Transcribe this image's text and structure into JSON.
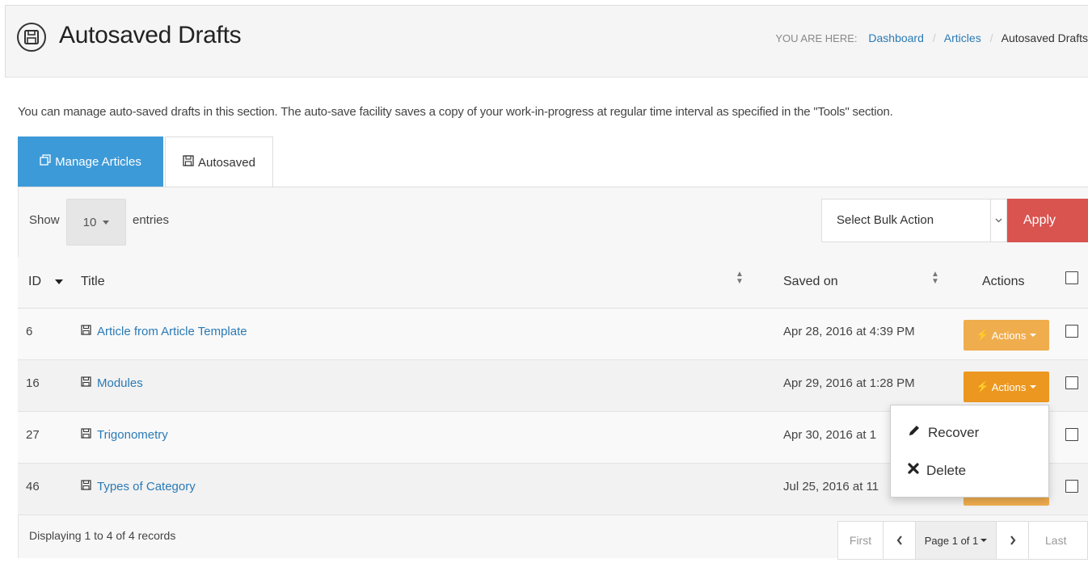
{
  "header": {
    "title": "Autosaved Drafts",
    "breadcrumb": {
      "label": "YOU ARE HERE:",
      "items": [
        "Dashboard",
        "Articles"
      ],
      "current": "Autosaved Drafts"
    }
  },
  "description": "You can manage auto-saved drafts in this section. The auto-save facility saves a copy of your work-in-progress at regular time interval as specified in the \"Tools\" section.",
  "tabs": [
    {
      "label": "Manage Articles",
      "icon": "copy-icon",
      "active": false
    },
    {
      "label": "Autosaved",
      "icon": "save-icon",
      "active": true
    }
  ],
  "toolbar": {
    "show_label": "Show",
    "page_length": "10",
    "entries_label": "entries",
    "bulk_action_placeholder": "Select Bulk Action",
    "apply_label": "Apply"
  },
  "table": {
    "columns": {
      "id": "ID",
      "title": "Title",
      "saved_on": "Saved on",
      "actions": "Actions"
    },
    "rows": [
      {
        "id": "6",
        "title": "Article from Article Template",
        "saved_on": "Apr 28, 2016 at 4:39 PM",
        "action_label": "Actions"
      },
      {
        "id": "16",
        "title": "Modules",
        "saved_on": "Apr 29, 2016 at 1:28 PM",
        "action_label": "Actions"
      },
      {
        "id": "27",
        "title": "Trigonometry",
        "saved_on": "Apr 30, 2016 at 1",
        "action_label": ""
      },
      {
        "id": "46",
        "title": "Types of Category",
        "saved_on": "Jul 25, 2016 at 11",
        "action_label": ""
      }
    ]
  },
  "dropdown": {
    "items": [
      {
        "label": "Recover",
        "icon": "pencil-icon"
      },
      {
        "label": "Delete",
        "icon": "x-icon"
      }
    ]
  },
  "footer": {
    "info": "Displaying 1 to 4 of 4 records",
    "pagination": {
      "first": "First",
      "page": "Page 1 of 1",
      "last": "Last"
    }
  },
  "colors": {
    "primary": "#3d9ad8",
    "danger": "#d9534f",
    "warning": "#f0ad4e",
    "link": "#2a7ab5"
  }
}
